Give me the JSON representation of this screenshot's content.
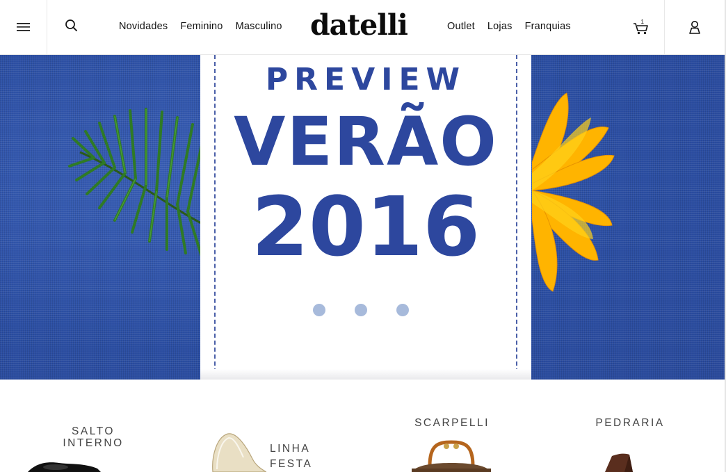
{
  "header": {
    "logo": "datelli",
    "nav_left": [
      "Novidades",
      "Feminino",
      "Masculino"
    ],
    "nav_right": [
      "Outlet",
      "Lojas",
      "Franquias"
    ],
    "cart_count": "1"
  },
  "hero": {
    "line1": "PREVIEW",
    "line2": "VERÃO",
    "line3": "2016",
    "slide_dots": 3
  },
  "categories": {
    "salto_interno": [
      "SALTO",
      "INTERNO"
    ],
    "linha_festa": [
      "LINHA",
      "FESTA"
    ],
    "scarpelli": "SCARPELLI",
    "pedraria": "PEDRARIA"
  },
  "colors": {
    "denim": "#2f52a8",
    "title_blue": "#2d479e",
    "dot": "#a7badb",
    "flower": "#ffb400"
  }
}
